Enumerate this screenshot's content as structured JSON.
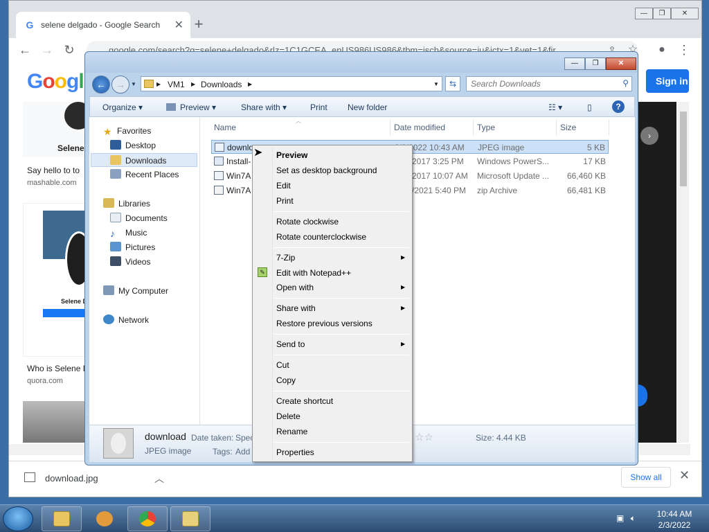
{
  "chrome": {
    "tab_title": "selene delgado - Google Search",
    "tab_close": "✕",
    "new_tab": "+",
    "url": "google.com/search?q=selene+delgado&rlz=1C1GCEA_enUS986US986&tbm=isch&source=iu&ictx=1&vet=1&fir",
    "page": {
      "logo": "Google",
      "sign_in": "Sign in",
      "result1_name": "Selene",
      "result1_caption": "Say hello to to",
      "result1_source": "mashable.com",
      "result2_name": "Selene D",
      "result2_caption": "Who is Selene D",
      "result2_source": "quora.com"
    },
    "download_shelf": {
      "file_name": "download.jpg",
      "show_all": "Show all",
      "close": "✕"
    }
  },
  "explorer": {
    "breadcrumb": [
      "VM1",
      "Downloads"
    ],
    "search_placeholder": "Search Downloads",
    "commands": [
      "Organize",
      "Preview",
      "Share with",
      "Print",
      "New folder"
    ],
    "nav": {
      "favorites": "Favorites",
      "desktop": "Desktop",
      "downloads": "Downloads",
      "recent": "Recent Places",
      "libraries": "Libraries",
      "documents": "Documents",
      "music": "Music",
      "pictures": "Pictures",
      "videos": "Videos",
      "computer": "My Computer",
      "network": "Network"
    },
    "columns": [
      "Name",
      "Date modified",
      "Type",
      "Size"
    ],
    "files": [
      {
        "name": "downlo",
        "date": "2/3/2022 10:43 AM",
        "type": "JPEG image",
        "size": "5 KB"
      },
      {
        "name": "Install-",
        "date": "2017 3:25 PM",
        "type": "Windows PowerS...",
        "size": "17 KB"
      },
      {
        "name": "Win7A",
        "date": "2017 10:07 AM",
        "type": "Microsoft Update ...",
        "size": "66,460 KB"
      },
      {
        "name": "Win7A",
        "date": "/2021 5:40 PM",
        "type": "zip Archive",
        "size": "66,481 KB"
      }
    ],
    "details": {
      "name": "download",
      "type": "JPEG image",
      "date_taken_label": "Date taken:",
      "date_taken_value": "Spec",
      "tags_label": "Tags:",
      "tags_value": "Add",
      "size": "Size: 4.44 KB",
      "rating": "☆☆"
    }
  },
  "context_menu": {
    "preview": "Preview",
    "set_desktop_bg": "Set as desktop background",
    "edit": "Edit",
    "print": "Print",
    "rotate_cw": "Rotate clockwise",
    "rotate_ccw": "Rotate counterclockwise",
    "seven_zip": "7-Zip",
    "edit_notepad": "Edit with Notepad++",
    "open_with": "Open with",
    "share_with": "Share with",
    "restore": "Restore previous versions",
    "send_to": "Send to",
    "cut": "Cut",
    "copy": "Copy",
    "create_shortcut": "Create shortcut",
    "delete": "Delete",
    "rename": "Rename",
    "properties": "Properties"
  },
  "taskbar": {
    "time": "10:44 AM",
    "date": "2/3/2022"
  }
}
